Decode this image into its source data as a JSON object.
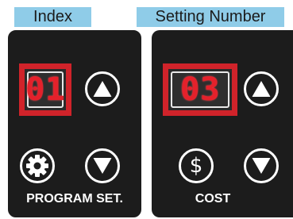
{
  "tabs": {
    "index_label": "Index",
    "setting_label": "Setting Number"
  },
  "program_panel": {
    "display_value": "01",
    "label": "PROGRAM SET.",
    "settings_icon": "gear-icon",
    "up_icon": "triangle-up-icon",
    "down_icon": "triangle-down-icon"
  },
  "cost_panel": {
    "display_value": "03",
    "label": "COST",
    "currency_icon": "dollar-icon",
    "currency_symbol": "$",
    "up_icon": "triangle-up-icon",
    "down_icon": "triangle-down-icon"
  },
  "colors": {
    "panel_bg": "#1c1c1c",
    "tab_bg": "#8fcce8",
    "highlight": "#d0232a",
    "digit": "#e4212b"
  }
}
